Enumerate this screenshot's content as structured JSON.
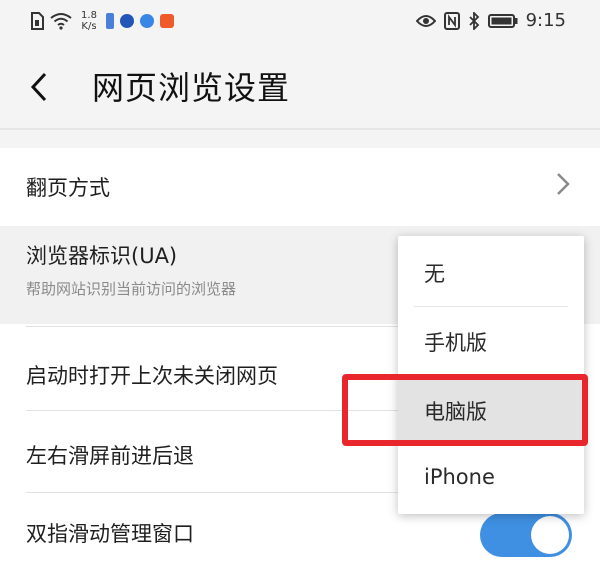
{
  "status_bar": {
    "net_speed_value": "1.8",
    "net_speed_unit": "K/s",
    "time": "9:15"
  },
  "header": {
    "back_icon": "chevron-left-icon",
    "title": "网页浏览设置"
  },
  "settings": {
    "page_turn_label": "翻页方式",
    "ua_label": "浏览器标识(UA)",
    "ua_desc": "帮助网站识别当前访问的浏览器",
    "restore_tabs_label": "启动时打开上次未关闭网页",
    "swipe_nav_label": "左右滑屏前进后退",
    "two_finger_label": "双指滑动管理窗口"
  },
  "ua_menu": {
    "options": [
      "无",
      "手机版",
      "电脑版",
      "iPhone"
    ],
    "selected": "电脑版"
  },
  "colors": {
    "toggle_on": "#3f90e3",
    "highlight_border": "#e8262c"
  }
}
